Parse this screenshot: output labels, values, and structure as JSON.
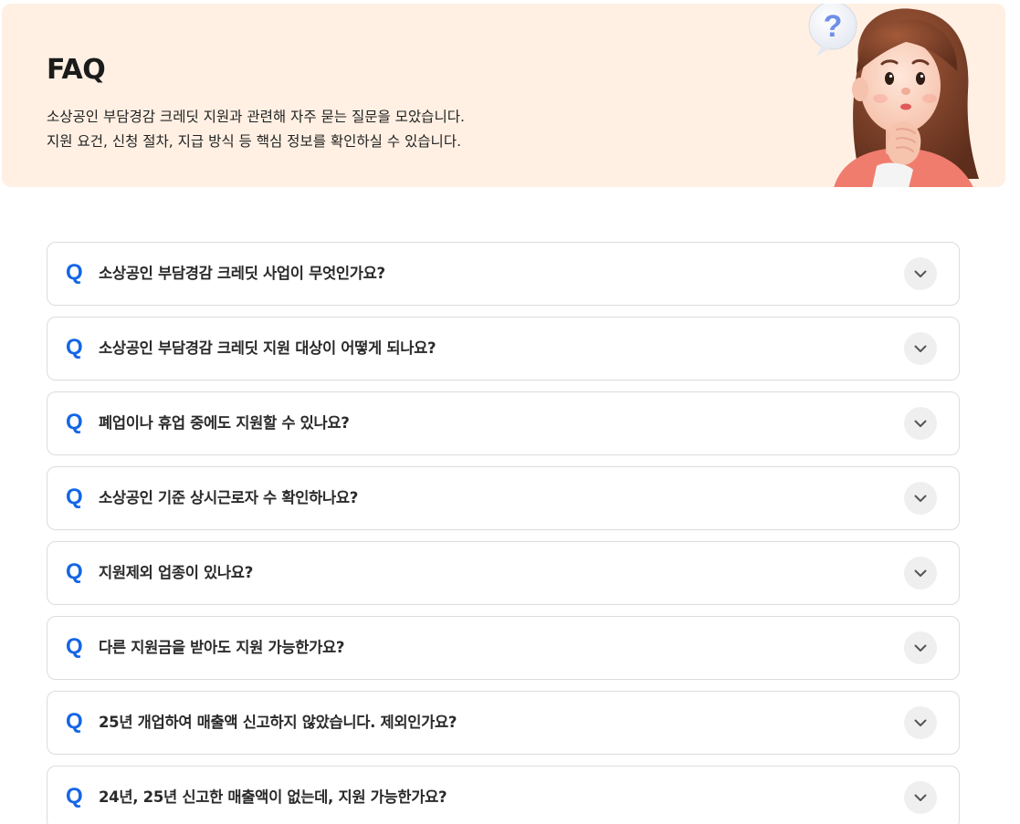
{
  "hero": {
    "title": "FAQ",
    "description_lines": [
      "소상공인 부담경감 크레딧 지원과 관련해 자주 묻는 질문을 모았습니다.",
      "지원 요건, 신청 절차, 지급 방식 등 핵심 정보를 확인하실 수 있습니다."
    ],
    "illustration_badge": "?"
  },
  "faq": {
    "q_marker": "Q",
    "items": [
      {
        "question": "소상공인 부담경감 크레딧 사업이 무엇인가요?"
      },
      {
        "question": "소상공인 부담경감 크레딧 지원 대상이 어떻게 되나요?"
      },
      {
        "question": "폐업이나 휴업 중에도 지원할 수 있나요?"
      },
      {
        "question": "소상공인 기준 상시근로자 수 확인하나요?"
      },
      {
        "question": "지원제외 업종이 있나요?"
      },
      {
        "question": "다른 지원금을 받아도 지원 가능한가요?"
      },
      {
        "question": "25년 개업하여 매출액 신고하지 않았습니다. 제외인가요?"
      },
      {
        "question": "24년, 25년 신고한 매출액이 없는데, 지원 가능한가요?"
      }
    ]
  },
  "icons": {
    "toggle": "chevron-down-icon",
    "illustration": "thinking-woman-illustration"
  },
  "colors": {
    "hero_bg": "#fff0e3",
    "accent": "#1466e6",
    "border": "#dcdcdc",
    "toggle_bg": "#efefef"
  }
}
